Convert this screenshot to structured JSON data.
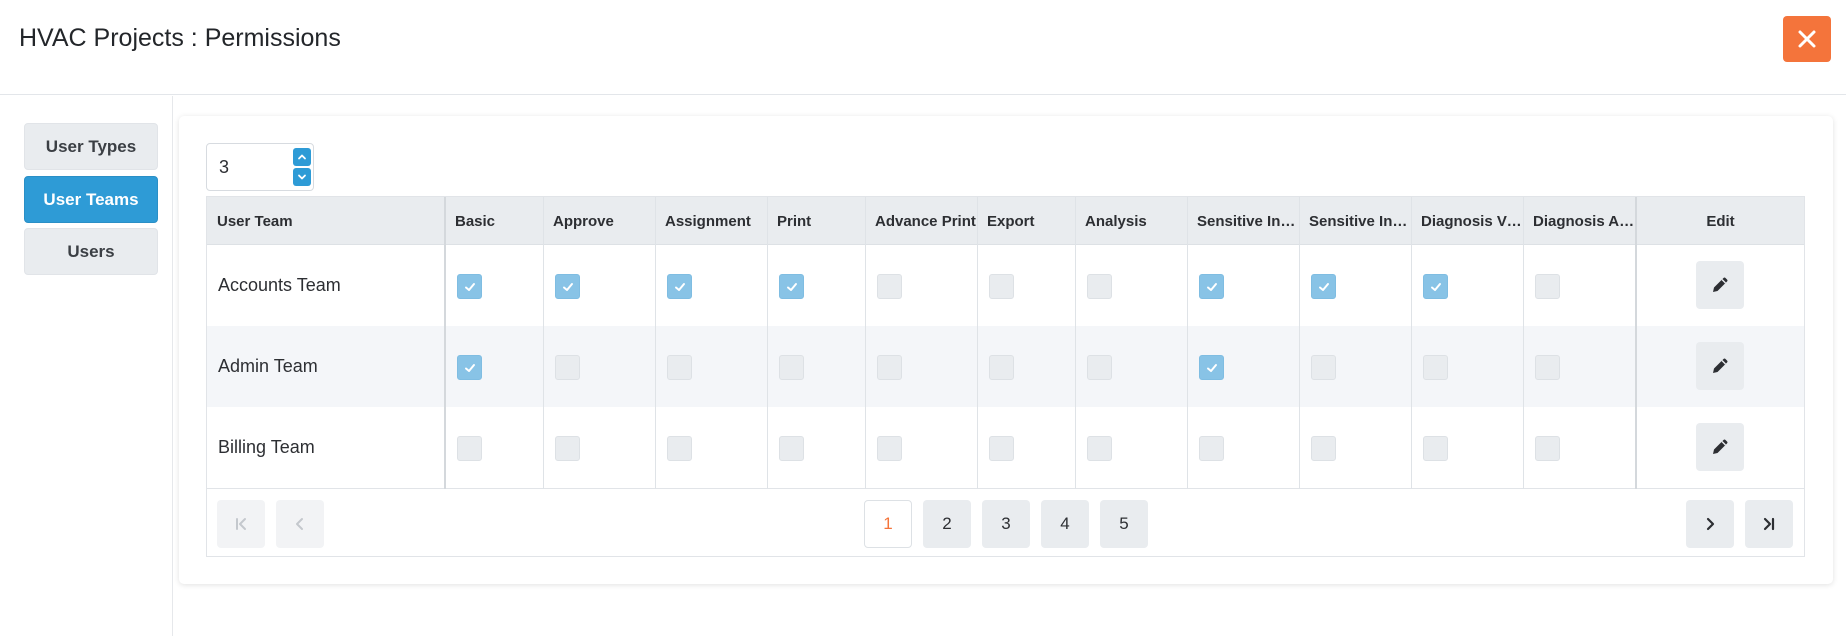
{
  "header": {
    "title": "HVAC Projects : Permissions",
    "close_icon": "close-icon"
  },
  "sidebar": {
    "items": [
      {
        "label": "User Types",
        "active": false
      },
      {
        "label": "User Teams",
        "active": true
      },
      {
        "label": "Users",
        "active": false
      }
    ]
  },
  "stepper": {
    "value": "3"
  },
  "table": {
    "first_column": "User Team",
    "permission_columns": [
      "Basic",
      "Approve",
      "Assignment",
      "Print",
      "Advance Print",
      "Export",
      "Analysis",
      "Sensitive Inf…",
      "Sensitive Inf…",
      "Diagnosis Vi…",
      "Diagnosis A…"
    ],
    "edit_column": "Edit",
    "rows": [
      {
        "team": "Accounts Team",
        "perms": [
          true,
          true,
          true,
          true,
          false,
          false,
          false,
          true,
          true,
          true,
          false
        ]
      },
      {
        "team": "Admin Team",
        "perms": [
          true,
          false,
          false,
          false,
          false,
          false,
          false,
          true,
          false,
          false,
          false
        ]
      },
      {
        "team": "Billing Team",
        "perms": [
          false,
          false,
          false,
          false,
          false,
          false,
          false,
          false,
          false,
          false,
          false
        ]
      }
    ]
  },
  "pagination": {
    "pages": [
      "1",
      "2",
      "3",
      "4",
      "5"
    ],
    "current_page": "1",
    "first_icon": "first-page-icon",
    "prev_icon": "chevron-left-icon",
    "next_icon": "chevron-right-icon",
    "last_icon": "last-page-icon"
  },
  "colors": {
    "accent": "#2e9bd6",
    "close": "#f4743b",
    "checked": "#88c3e6",
    "current_page_text": "#f4743b"
  }
}
